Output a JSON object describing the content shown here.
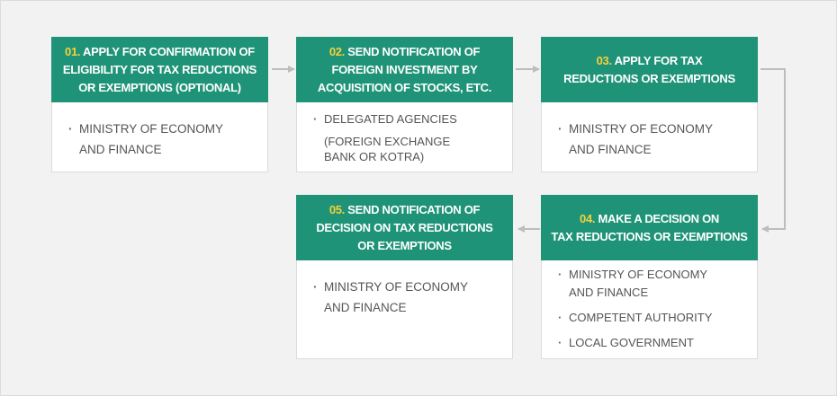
{
  "steps": [
    {
      "num": "01.",
      "title": "APPLY FOR CONFIRMATION OF ELIGIBILITY FOR TAX REDUCTIONS OR EXEMPTIONS (OPTIONAL)",
      "title_lines": [
        "APPLY FOR CONFIRMATION OF",
        "ELIGIBILITY FOR TAX REDUCTIONS",
        "OR EXEMPTIONS (OPTIONAL)"
      ],
      "items": [
        [
          "MINISTRY OF ECONOMY",
          "AND FINANCE"
        ]
      ]
    },
    {
      "num": "02.",
      "title_lines": [
        "SEND NOTIFICATION OF",
        "FOREIGN INVESTMENT BY",
        "ACQUISITION OF STOCKS, ETC."
      ],
      "items": [
        [
          "DELEGATED AGENCIES",
          "(FOREIGN EXCHANGE",
          "BANK OR KOTRA)"
        ]
      ]
    },
    {
      "num": "03.",
      "title_lines": [
        "APPLY FOR TAX",
        "REDUCTIONS OR EXEMPTIONS"
      ],
      "items": [
        [
          "MINISTRY OF ECONOMY",
          "AND FINANCE"
        ]
      ]
    },
    {
      "num": "04.",
      "title_lines": [
        "MAKE A DECISION ON",
        "TAX REDUCTIONS OR EXEMPTIONS"
      ],
      "items": [
        [
          "MINISTRY OF ECONOMY",
          "AND FINANCE"
        ],
        [
          "COMPETENT AUTHORITY"
        ],
        [
          "LOCAL GOVERNMENT"
        ]
      ]
    },
    {
      "num": "05.",
      "title_lines": [
        "SEND NOTIFICATION OF",
        "DECISION ON TAX REDUCTIONS",
        "OR EXEMPTIONS"
      ],
      "items": [
        [
          "MINISTRY OF ECONOMY",
          "AND FINANCE"
        ]
      ]
    }
  ]
}
